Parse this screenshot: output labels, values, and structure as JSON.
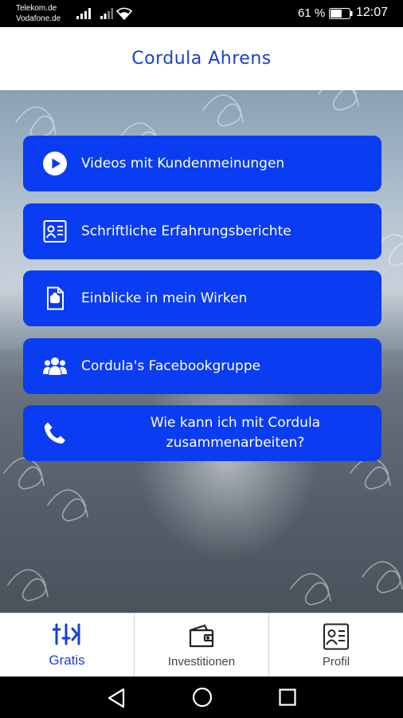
{
  "status_bar": {
    "carrier_1": "Telekom.de",
    "carrier_2": "Vodafone.de",
    "battery_percent": "61 %",
    "battery_level": 0.61,
    "time": "12:07"
  },
  "header": {
    "title": "Cordula Ahrens"
  },
  "menu": {
    "items": [
      {
        "label": "Videos mit Kundenmeinungen",
        "icon": "play-icon"
      },
      {
        "label": "Schriftliche Erfahrungsberichte",
        "icon": "id-card-icon"
      },
      {
        "label": "Einblicke in mein Wirken",
        "icon": "document-icon"
      },
      {
        "label": "Cordula's Facebookgruppe",
        "icon": "users-icon"
      },
      {
        "label": "Wie kann ich mit Cordula zusammenarbeiten?",
        "icon": "phone-icon"
      }
    ]
  },
  "tabs": [
    {
      "label": "Gratis",
      "icon": "sliders-icon",
      "active": true
    },
    {
      "label": "Investitionen",
      "icon": "wallet-icon",
      "active": false
    },
    {
      "label": "Profil",
      "icon": "profile-card-icon",
      "active": false
    }
  ],
  "colors": {
    "accent": "#0a3cf2",
    "title": "#1a3fd4",
    "tab_active": "#1a3fd4",
    "tab_inactive": "#444444"
  }
}
